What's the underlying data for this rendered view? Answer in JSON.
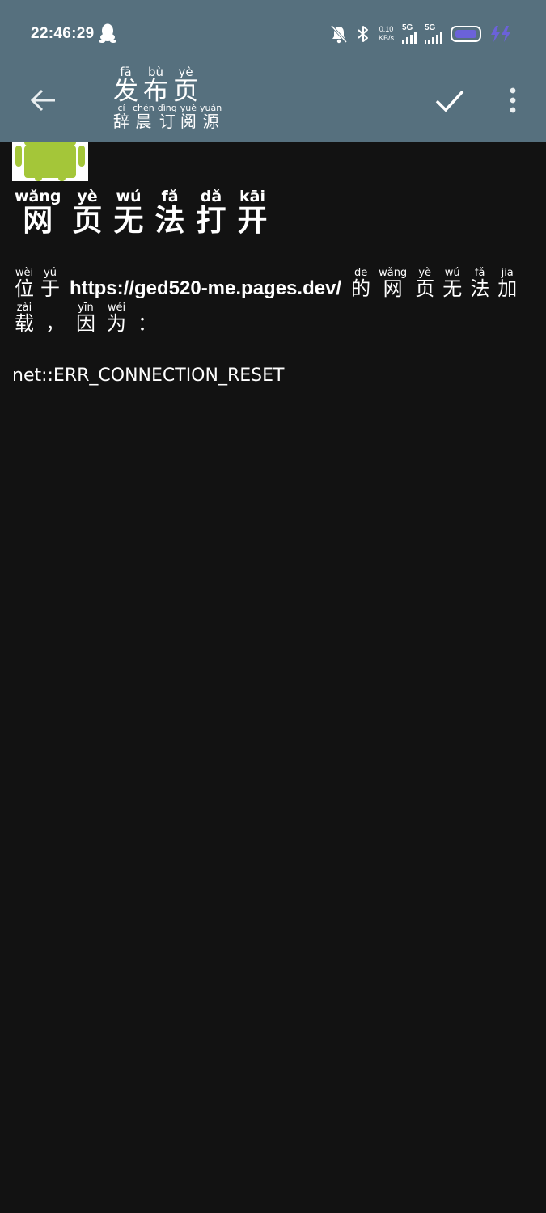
{
  "status_bar": {
    "time": "22:46:29",
    "net_speed_value": "0.10",
    "net_speed_unit": "KB/s",
    "sim1_label": "5G",
    "sim2_label": "5G"
  },
  "app_bar": {
    "title": {
      "hz": [
        "发",
        "布",
        "页"
      ],
      "py": [
        "fā",
        "bù",
        "yè"
      ]
    },
    "subtitle": {
      "hz": [
        "辞",
        "晨",
        "订",
        "阅",
        "源"
      ],
      "py": [
        "cí",
        "chén",
        "dìng",
        "yuè",
        "yuán"
      ]
    }
  },
  "page": {
    "heading": {
      "hz": [
        "网",
        "页",
        "无",
        "法",
        "打",
        "开"
      ],
      "py": [
        "wǎng",
        "yè",
        "wú",
        "fǎ",
        "dǎ",
        "kāi"
      ]
    },
    "msg_pre": {
      "hz": [
        "位",
        "于"
      ],
      "py": [
        "wèi",
        "yú"
      ]
    },
    "url": "https://ged520-me.pages.dev/",
    "msg_post": {
      "hz": [
        "的",
        "网",
        "页",
        "无",
        "法",
        "加"
      ],
      "py": [
        "de",
        "wǎng",
        "yè",
        "wú",
        "fǎ",
        "jiā"
      ]
    },
    "msg_line2": {
      "hz": [
        "载",
        "，",
        "因",
        "为",
        "："
      ],
      "py": [
        "zài",
        "",
        "yīn",
        "wéi",
        ""
      ]
    },
    "error_code": "net::ERR_CONNECTION_RESET"
  },
  "colors": {
    "appbar_bg": "#56707e",
    "page_bg": "#121212",
    "battery_accent": "#6b62d9",
    "android_green": "#a4c639"
  },
  "icons": [
    "back-arrow-icon",
    "check-icon",
    "more-vert-icon",
    "qq-icon",
    "bell-off-icon",
    "bluetooth-icon",
    "battery-icon",
    "android-icon"
  ]
}
